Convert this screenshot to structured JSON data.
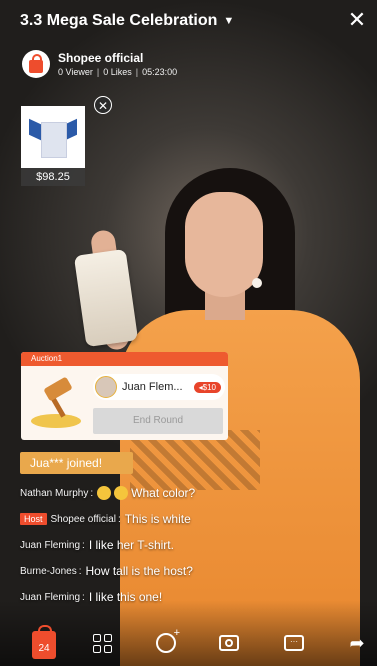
{
  "header": {
    "title": "3.3 Mega Sale Celebration",
    "caret_icon": "caret-down-icon",
    "close_icon": "close-icon"
  },
  "shop": {
    "name": "Shopee official",
    "viewers": "0 Viewer",
    "likes": "0 Likes",
    "duration": "05:23:00",
    "avatar_icon": "shopee-bag-icon"
  },
  "product": {
    "price": "$98.25",
    "image_icon": "tshirt-icon",
    "close_icon": "close-icon"
  },
  "auction": {
    "label": "Auction1",
    "bidder_name": "Juan Flem...",
    "bid": "$10",
    "end_round": "End Round",
    "image_icon": "gavel-icon"
  },
  "joined": "Jua*** joined!",
  "comments": [
    {
      "user": "Nathan Murphy",
      "text": "What color?",
      "emojis": 2
    },
    {
      "user": "Shopee official",
      "text": "This is white",
      "host_label": "Host"
    },
    {
      "user": "Juan Fleming",
      "text": "I like her T-shirt."
    },
    {
      "user": "Burne-Jones",
      "text": "How tall is the host?"
    },
    {
      "user": "Juan Fleming",
      "text": "I like this one!"
    }
  ],
  "bottom_bar": {
    "cart_count": "24",
    "icons": [
      "cart-icon",
      "grid-icon",
      "sticker-icon",
      "camera-icon",
      "chat-icon",
      "share-icon"
    ]
  },
  "colors": {
    "brand": "#ee4d2d",
    "joined_bg": "#e9a84c"
  }
}
